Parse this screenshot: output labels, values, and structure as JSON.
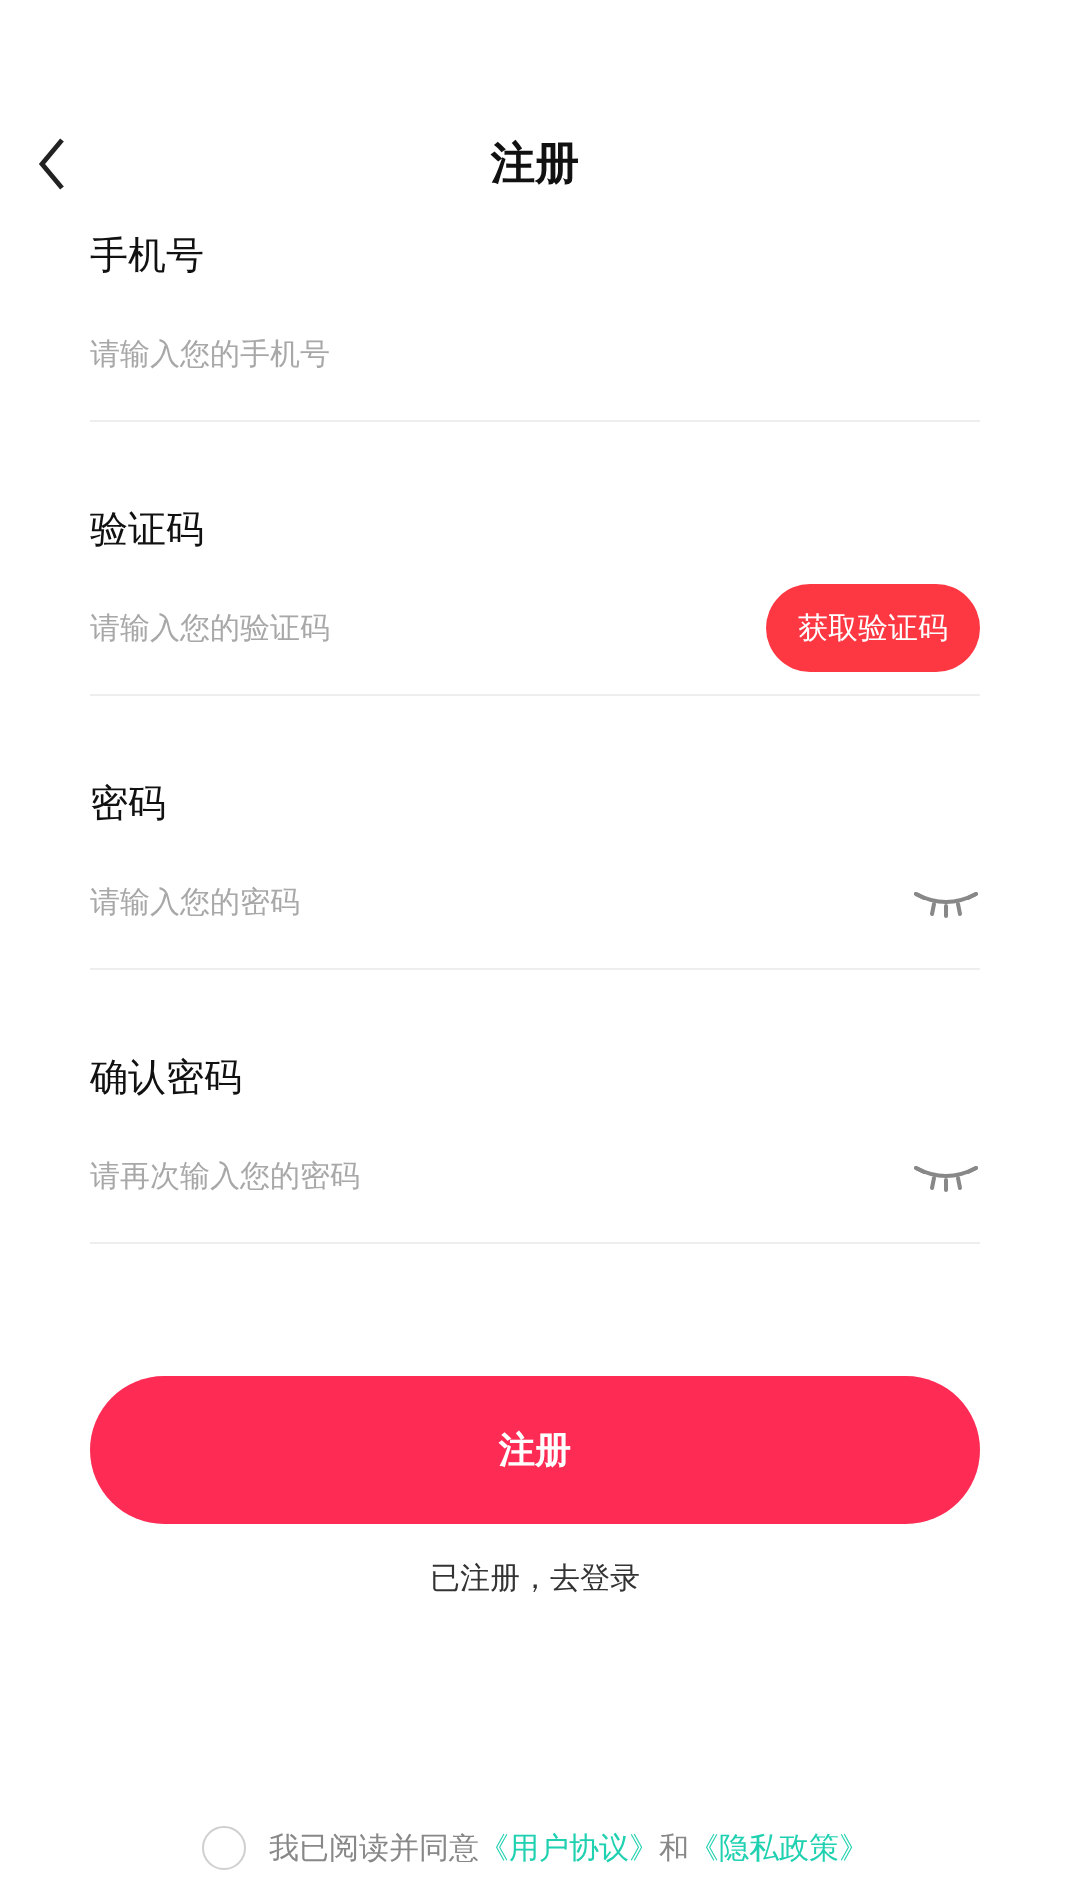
{
  "header": {
    "title": "注册"
  },
  "fields": [
    {
      "kind": "plain",
      "label": "手机号",
      "placeholder": "请输入您的手机号"
    },
    {
      "kind": "code",
      "label": "验证码",
      "placeholder": "请输入您的验证码",
      "action": "获取验证码"
    },
    {
      "kind": "password",
      "label": "密码",
      "placeholder": "请输入您的密码"
    },
    {
      "kind": "password",
      "label": "确认密码",
      "placeholder": "请再次输入您的密码"
    }
  ],
  "submit": "注册",
  "login_link": "已注册，去登录",
  "agreement": {
    "checked": false,
    "parts": [
      {
        "kind": "text",
        "text": "我已阅读并同意"
      },
      {
        "kind": "link",
        "text": "《用户协议》"
      },
      {
        "kind": "text",
        "text": "和"
      },
      {
        "kind": "link",
        "text": "《隐私政策》"
      }
    ]
  }
}
